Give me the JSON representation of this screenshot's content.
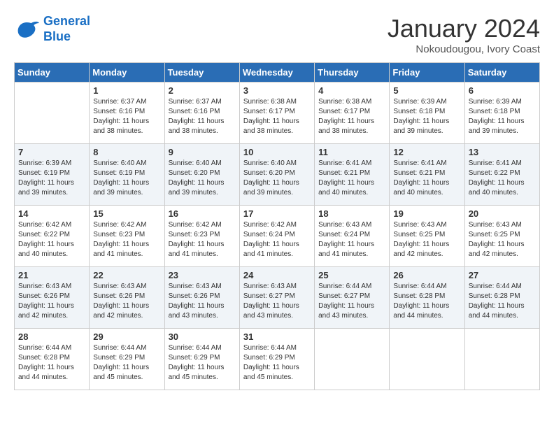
{
  "logo": {
    "line1": "General",
    "line2": "Blue"
  },
  "title": "January 2024",
  "subtitle": "Nokoudougou, Ivory Coast",
  "days_of_week": [
    "Sunday",
    "Monday",
    "Tuesday",
    "Wednesday",
    "Thursday",
    "Friday",
    "Saturday"
  ],
  "weeks": [
    [
      {
        "day": "",
        "info": ""
      },
      {
        "day": "1",
        "info": "Sunrise: 6:37 AM\nSunset: 6:16 PM\nDaylight: 11 hours\nand 38 minutes."
      },
      {
        "day": "2",
        "info": "Sunrise: 6:37 AM\nSunset: 6:16 PM\nDaylight: 11 hours\nand 38 minutes."
      },
      {
        "day": "3",
        "info": "Sunrise: 6:38 AM\nSunset: 6:17 PM\nDaylight: 11 hours\nand 38 minutes."
      },
      {
        "day": "4",
        "info": "Sunrise: 6:38 AM\nSunset: 6:17 PM\nDaylight: 11 hours\nand 38 minutes."
      },
      {
        "day": "5",
        "info": "Sunrise: 6:39 AM\nSunset: 6:18 PM\nDaylight: 11 hours\nand 39 minutes."
      },
      {
        "day": "6",
        "info": "Sunrise: 6:39 AM\nSunset: 6:18 PM\nDaylight: 11 hours\nand 39 minutes."
      }
    ],
    [
      {
        "day": "7",
        "info": "Sunrise: 6:39 AM\nSunset: 6:19 PM\nDaylight: 11 hours\nand 39 minutes."
      },
      {
        "day": "8",
        "info": "Sunrise: 6:40 AM\nSunset: 6:19 PM\nDaylight: 11 hours\nand 39 minutes."
      },
      {
        "day": "9",
        "info": "Sunrise: 6:40 AM\nSunset: 6:20 PM\nDaylight: 11 hours\nand 39 minutes."
      },
      {
        "day": "10",
        "info": "Sunrise: 6:40 AM\nSunset: 6:20 PM\nDaylight: 11 hours\nand 39 minutes."
      },
      {
        "day": "11",
        "info": "Sunrise: 6:41 AM\nSunset: 6:21 PM\nDaylight: 11 hours\nand 40 minutes."
      },
      {
        "day": "12",
        "info": "Sunrise: 6:41 AM\nSunset: 6:21 PM\nDaylight: 11 hours\nand 40 minutes."
      },
      {
        "day": "13",
        "info": "Sunrise: 6:41 AM\nSunset: 6:22 PM\nDaylight: 11 hours\nand 40 minutes."
      }
    ],
    [
      {
        "day": "14",
        "info": "Sunrise: 6:42 AM\nSunset: 6:22 PM\nDaylight: 11 hours\nand 40 minutes."
      },
      {
        "day": "15",
        "info": "Sunrise: 6:42 AM\nSunset: 6:23 PM\nDaylight: 11 hours\nand 41 minutes."
      },
      {
        "day": "16",
        "info": "Sunrise: 6:42 AM\nSunset: 6:23 PM\nDaylight: 11 hours\nand 41 minutes."
      },
      {
        "day": "17",
        "info": "Sunrise: 6:42 AM\nSunset: 6:24 PM\nDaylight: 11 hours\nand 41 minutes."
      },
      {
        "day": "18",
        "info": "Sunrise: 6:43 AM\nSunset: 6:24 PM\nDaylight: 11 hours\nand 41 minutes."
      },
      {
        "day": "19",
        "info": "Sunrise: 6:43 AM\nSunset: 6:25 PM\nDaylight: 11 hours\nand 42 minutes."
      },
      {
        "day": "20",
        "info": "Sunrise: 6:43 AM\nSunset: 6:25 PM\nDaylight: 11 hours\nand 42 minutes."
      }
    ],
    [
      {
        "day": "21",
        "info": "Sunrise: 6:43 AM\nSunset: 6:26 PM\nDaylight: 11 hours\nand 42 minutes."
      },
      {
        "day": "22",
        "info": "Sunrise: 6:43 AM\nSunset: 6:26 PM\nDaylight: 11 hours\nand 42 minutes."
      },
      {
        "day": "23",
        "info": "Sunrise: 6:43 AM\nSunset: 6:26 PM\nDaylight: 11 hours\nand 43 minutes."
      },
      {
        "day": "24",
        "info": "Sunrise: 6:43 AM\nSunset: 6:27 PM\nDaylight: 11 hours\nand 43 minutes."
      },
      {
        "day": "25",
        "info": "Sunrise: 6:44 AM\nSunset: 6:27 PM\nDaylight: 11 hours\nand 43 minutes."
      },
      {
        "day": "26",
        "info": "Sunrise: 6:44 AM\nSunset: 6:28 PM\nDaylight: 11 hours\nand 44 minutes."
      },
      {
        "day": "27",
        "info": "Sunrise: 6:44 AM\nSunset: 6:28 PM\nDaylight: 11 hours\nand 44 minutes."
      }
    ],
    [
      {
        "day": "28",
        "info": "Sunrise: 6:44 AM\nSunset: 6:28 PM\nDaylight: 11 hours\nand 44 minutes."
      },
      {
        "day": "29",
        "info": "Sunrise: 6:44 AM\nSunset: 6:29 PM\nDaylight: 11 hours\nand 45 minutes."
      },
      {
        "day": "30",
        "info": "Sunrise: 6:44 AM\nSunset: 6:29 PM\nDaylight: 11 hours\nand 45 minutes."
      },
      {
        "day": "31",
        "info": "Sunrise: 6:44 AM\nSunset: 6:29 PM\nDaylight: 11 hours\nand 45 minutes."
      },
      {
        "day": "",
        "info": ""
      },
      {
        "day": "",
        "info": ""
      },
      {
        "day": "",
        "info": ""
      }
    ]
  ]
}
